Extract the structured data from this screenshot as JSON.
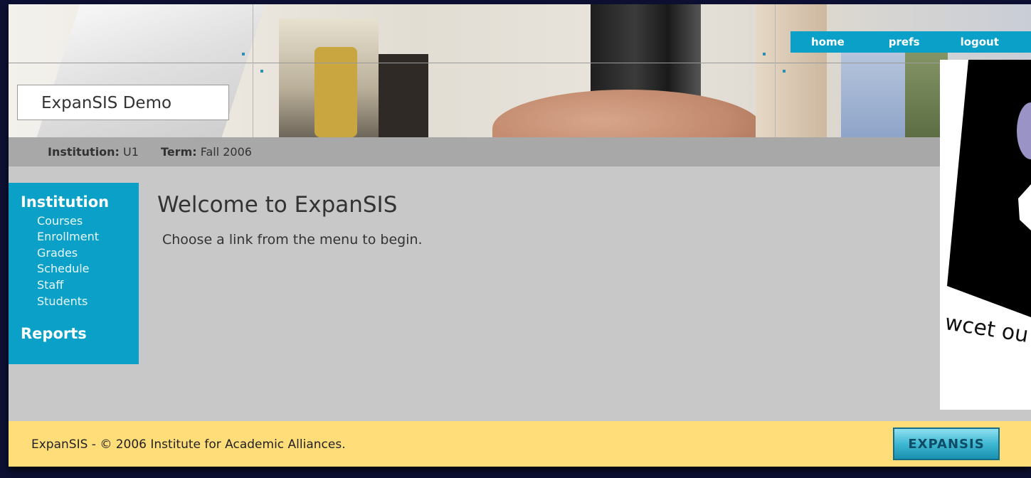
{
  "header": {
    "app_title": "ExpanSIS Demo",
    "nav": [
      "home",
      "prefs",
      "logout"
    ]
  },
  "infobar": {
    "institution_label": "Institution:",
    "institution_value": "U1",
    "term_label": "Term:",
    "term_value": "Fall 2006"
  },
  "sidebar": {
    "sections": [
      {
        "label": "Institution",
        "items": [
          "Courses",
          "Enrollment",
          "Grades",
          "Schedule",
          "Staff",
          "Students"
        ]
      },
      {
        "label": "Reports",
        "items": []
      }
    ]
  },
  "main": {
    "heading": "Welcome to ExpanSIS",
    "text": "Choose a link from the menu to begin."
  },
  "footer": {
    "copyright": "ExpanSIS - © 2006 Institute for Academic Alliances.",
    "logo_text": "EXPANSIS"
  },
  "overlay": {
    "wordmark": "wcet ou"
  },
  "colors": {
    "accent": "#0aa0c8",
    "footer": "#ffde7a",
    "infobar": "#a8a8a8",
    "content_bg": "#c8c8c8"
  }
}
